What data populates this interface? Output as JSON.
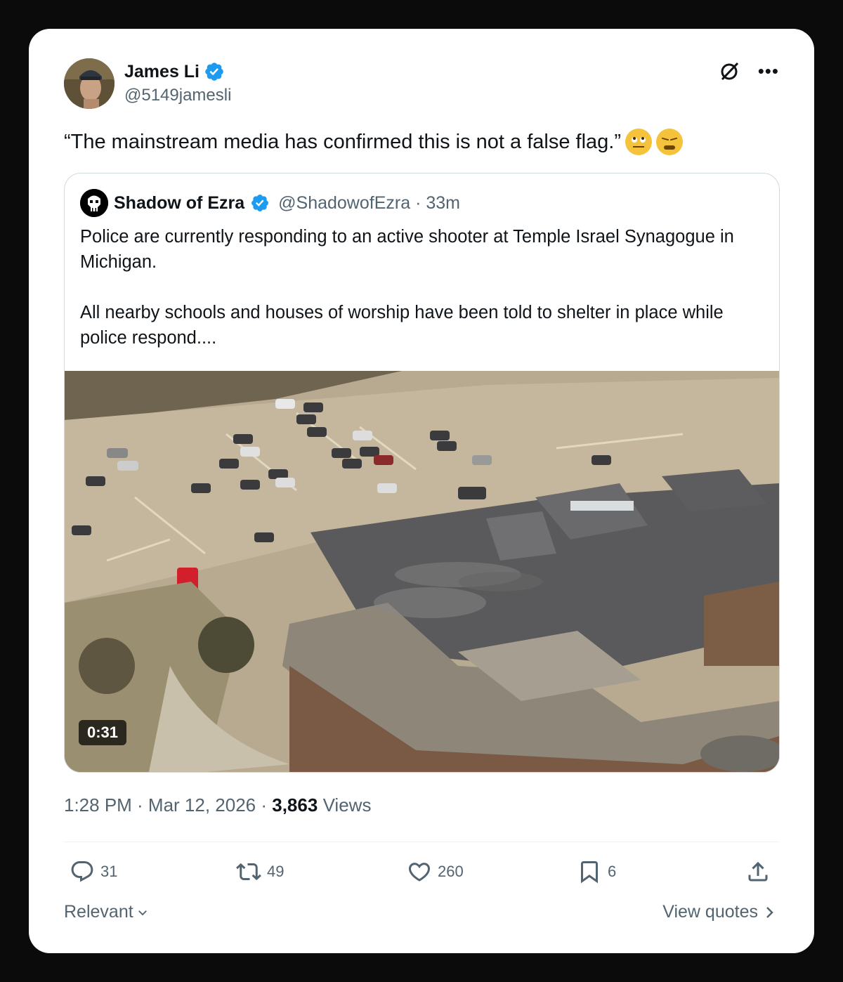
{
  "author": {
    "name": "James Li",
    "handle": "@5149jamesli",
    "verified": true
  },
  "tweet": {
    "text": "“The mainstream media has confirmed this is not a false flag.”"
  },
  "quoted_tweet": {
    "author_name": "Shadow of Ezra",
    "handle_time": "@ShadowofEzra · 33m",
    "paragraph_1": "Police are currently responding to an active shooter at Temple Israel Synagogue in Michigan.",
    "paragraph_2": "All nearby schools and houses of worship have been told to shelter in place while police respond....",
    "video_duration": "0:31"
  },
  "meta": {
    "time_date": "1:28 PM · Mar 12, 2026 · ",
    "views_count": "3,863",
    "views_label": "Views"
  },
  "actions": {
    "replies": "31",
    "reposts": "49",
    "likes": "260",
    "bookmarks": "6"
  },
  "footer": {
    "sort_label": "Relevant",
    "view_quotes": "View quotes"
  },
  "icons": [
    "verified-badge-icon",
    "grok-icon",
    "more-icon",
    "reply-icon",
    "repost-icon",
    "like-icon",
    "bookmark-icon",
    "share-icon",
    "chevron-down-icon",
    "chevron-right-icon"
  ],
  "colors": {
    "verified_blue": "#1d9bf0",
    "text_primary": "#0f1419",
    "text_secondary": "#536471",
    "border": "#cfd9de"
  }
}
